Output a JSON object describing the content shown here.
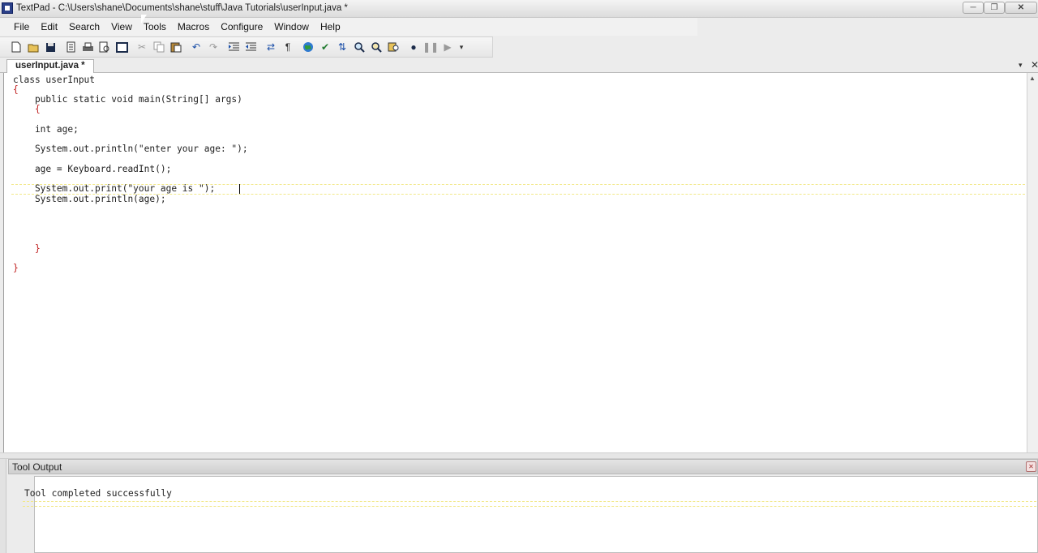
{
  "window": {
    "title": "TextPad - C:\\Users\\shane\\Documents\\shane\\stuff\\Java Tutorials\\userInput.java *",
    "minimize_glyph": "─",
    "maximize_glyph": "❐",
    "close_glyph": "✕"
  },
  "menu": [
    "File",
    "Edit",
    "Search",
    "View",
    "Tools",
    "Macros",
    "Configure",
    "Window",
    "Help"
  ],
  "toolbar": {
    "icons": [
      "new-file-icon",
      "open-folder-icon",
      "save-icon",
      "save-all-icon",
      "print-icon",
      "print-preview-icon",
      "spell-check-icon",
      "cut-icon",
      "copy-icon",
      "paste-icon",
      "undo-icon",
      "redo-icon",
      "indent-icon",
      "outdent-icon",
      "word-wrap-icon",
      "pilcrow-icon",
      "web-browser-icon",
      "check-icon",
      "sort-icon",
      "find-icon",
      "replace-icon",
      "find-in-files-icon",
      "record-macro-icon",
      "pause-macro-icon",
      "play-macro-icon",
      "toolbar-overflow-icon"
    ],
    "pilcrow": "¶",
    "overflow": "▾"
  },
  "tabs": {
    "active": "userInput.java *",
    "dropdown_glyph": "▾",
    "close_glyph": "✕"
  },
  "editor": {
    "lines": [
      "class userInput",
      "{",
      "    public static void main(String[] args)",
      "    {",
      "",
      "    int age;",
      "",
      "    System.out.println(\"enter your age: \");",
      "",
      "    age = Keyboard.readInt();",
      "",
      "    System.out.print(\"your age is \");",
      "    System.out.println(age);",
      "",
      "",
      "",
      "",
      "    }",
      "",
      "}"
    ]
  },
  "tool_output": {
    "title": "Tool Output",
    "close_glyph": "✕",
    "message": "Tool completed successfully"
  }
}
